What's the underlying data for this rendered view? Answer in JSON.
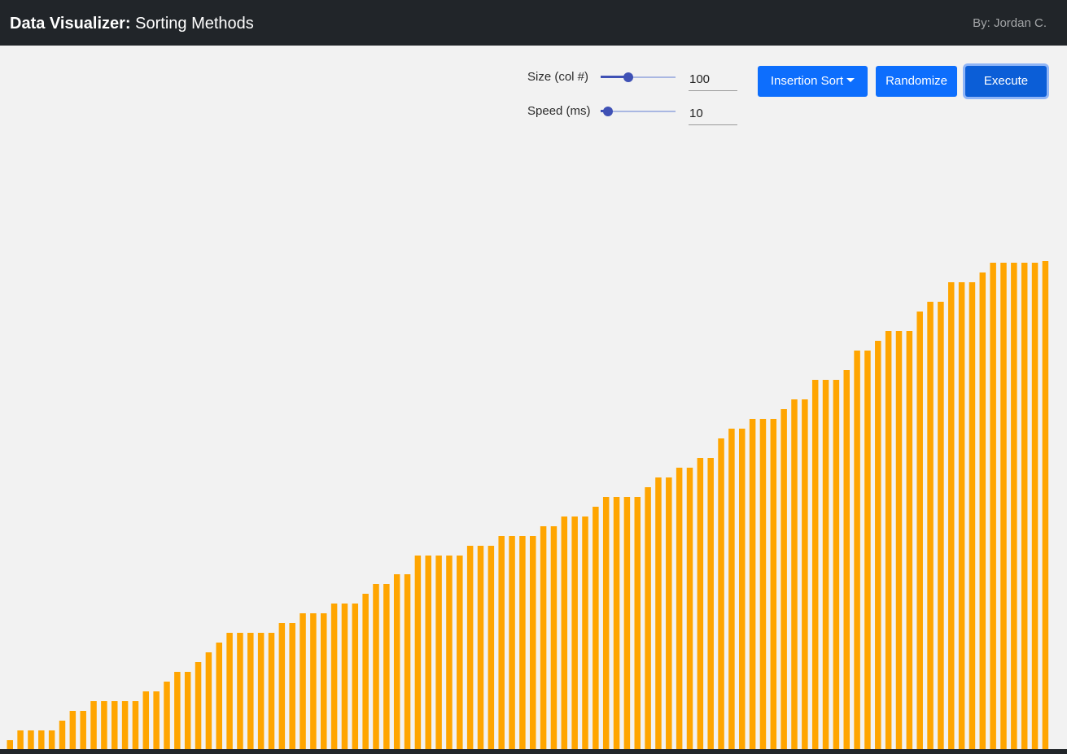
{
  "header": {
    "brand_bold": "Data Visualizer:",
    "brand_rest": " Sorting Methods",
    "author": "By: Jordan C."
  },
  "controls": {
    "size": {
      "label": "Size (col #)",
      "value": "100",
      "slider_fraction": 0.37
    },
    "speed": {
      "label": "Speed (ms)",
      "value": "10",
      "slider_fraction": 0.1
    }
  },
  "buttons": {
    "algorithm": "Insertion Sort",
    "randomize": "Randomize",
    "execute": "Execute"
  },
  "colors": {
    "bar": "#ffa500",
    "navbar": "#212529",
    "button": "#0d6efd",
    "background": "#f2f2f2"
  },
  "chart_data": {
    "type": "bar",
    "categories": [],
    "values": [
      11,
      23,
      23,
      23,
      23,
      35,
      47,
      47,
      59,
      59,
      59,
      59,
      59,
      71,
      71,
      83,
      95,
      95,
      107,
      119,
      131,
      143,
      143,
      143,
      143,
      143,
      155,
      155,
      167,
      167,
      167,
      179,
      179,
      179,
      191,
      203,
      203,
      215,
      215,
      238,
      238,
      238,
      238,
      238,
      250,
      250,
      250,
      262,
      262,
      262,
      262,
      274,
      274,
      286,
      286,
      286,
      298,
      310,
      310,
      310,
      310,
      322,
      334,
      334,
      346,
      346,
      358,
      358,
      382,
      394,
      394,
      406,
      406,
      406,
      418,
      430,
      430,
      454,
      454,
      454,
      466,
      490,
      490,
      502,
      514,
      514,
      514,
      538,
      550,
      550,
      574,
      574,
      574,
      586,
      598,
      598,
      598,
      598,
      598,
      600
    ]
  }
}
